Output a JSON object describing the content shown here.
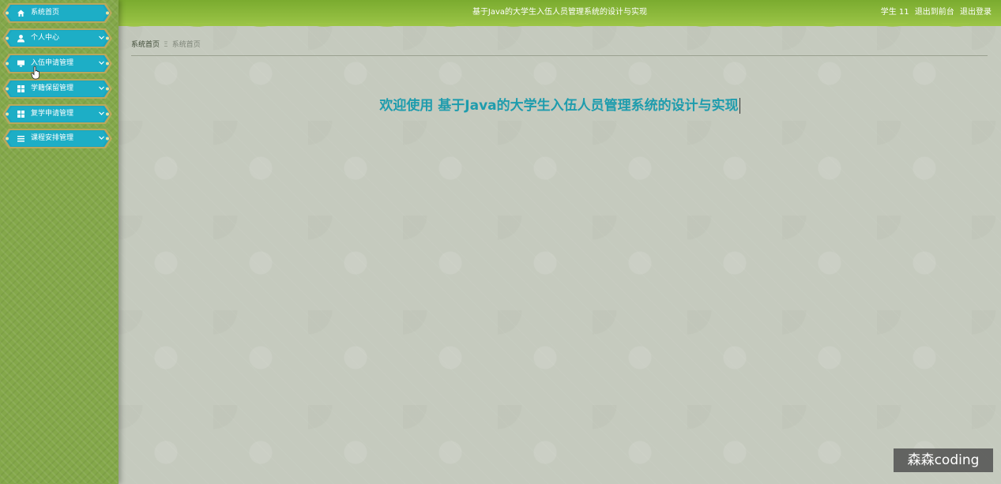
{
  "sidebar": {
    "items": [
      {
        "label": "系统首页",
        "icon": "home-icon"
      },
      {
        "label": "个人中心",
        "icon": "user-icon"
      },
      {
        "label": "入伍申请管理",
        "icon": "monitor-icon"
      },
      {
        "label": "学籍保留管理",
        "icon": "grid-icon"
      },
      {
        "label": "复学申请管理",
        "icon": "grid-icon"
      },
      {
        "label": "课程安排管理",
        "icon": "list-icon"
      }
    ]
  },
  "header": {
    "title": "基于Java的大学生入伍人员管理系统的设计与实现",
    "user": "学生 11",
    "to_front": "退出到前台",
    "logout": "退出登录"
  },
  "breadcrumb": {
    "home": "系统首页",
    "separator": "Ξ",
    "current": "系统首页"
  },
  "main": {
    "welcome": "欢迎使用 基于Java的大学生入伍人员管理系统的设计与实现"
  },
  "watermark": "森森coding",
  "colors": {
    "sidebar": "#84a84a",
    "nav_item": "#1aa3bc",
    "nav_border": "#c8b56a",
    "topbar": "#8ab83c",
    "welcome_text": "#1e9cad",
    "content_bg": "#c5cabe"
  }
}
